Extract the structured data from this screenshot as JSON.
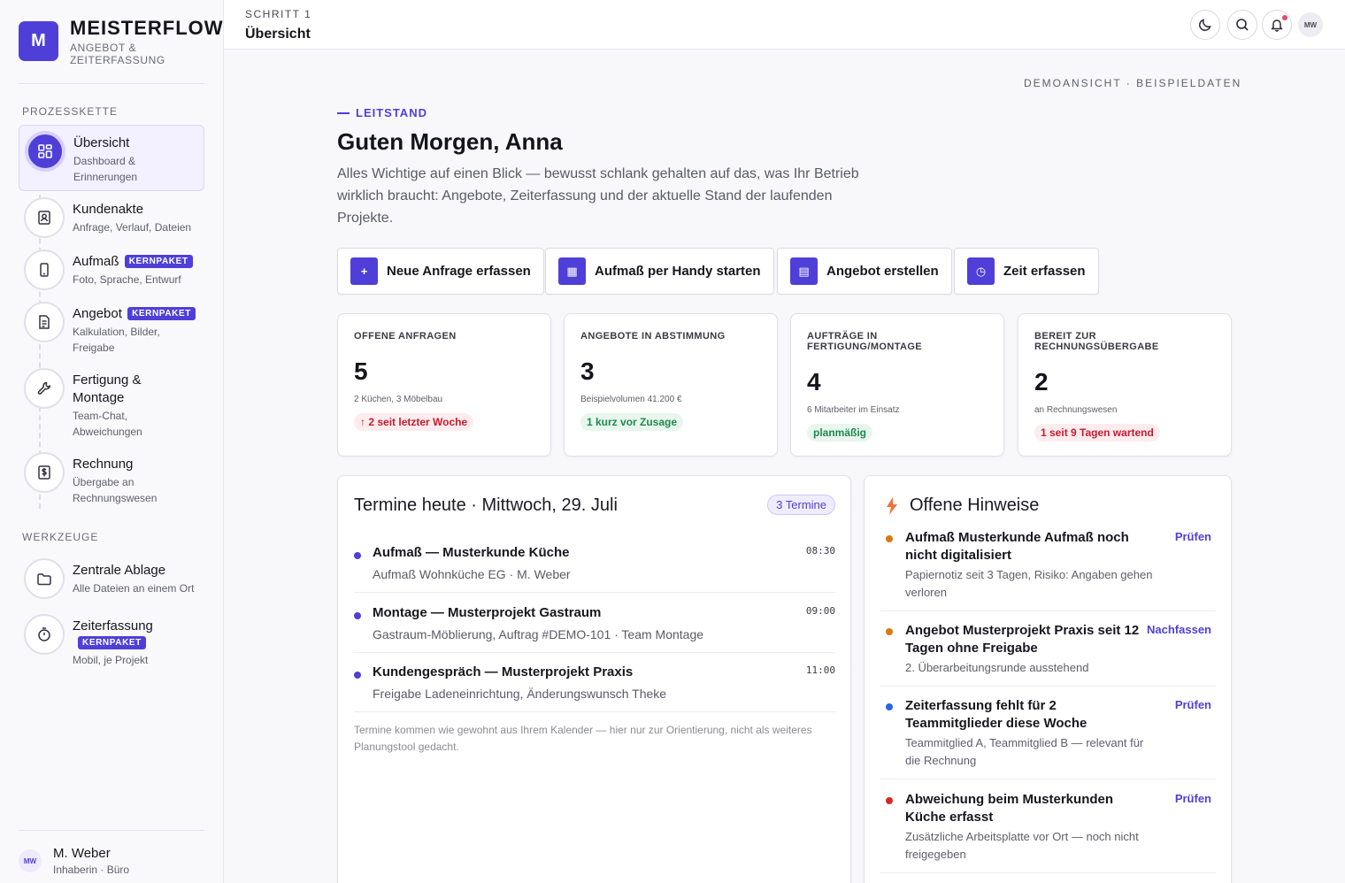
{
  "brand": {
    "logo_letter": "M",
    "name": "MEISTERFLOW",
    "subtitle": "ANGEBOT & ZEITERFASSUNG"
  },
  "sidebar": {
    "section_process": "PROZESSKETTE",
    "section_tools": "WERKZEUGE",
    "items": [
      {
        "title": "Übersicht",
        "sub": "Dashboard & Erinnerungen",
        "icon": "dashboard-icon"
      },
      {
        "title": "Kundenakte",
        "sub": "Anfrage, Verlauf, Dateien",
        "icon": "contact-card-icon"
      },
      {
        "title": "Aufmaß",
        "badge": "KERNPAKET",
        "sub": "Foto, Sprache, Entwurf",
        "icon": "phone-icon"
      },
      {
        "title": "Angebot",
        "badge": "KERNPAKET",
        "sub": "Kalkulation, Bilder, Freigabe",
        "icon": "document-icon"
      },
      {
        "title": "Fertigung & Montage",
        "sub": "Team-Chat, Abweichungen",
        "icon": "wrench-icon"
      },
      {
        "title": "Rechnung",
        "sub": "Übergabe an Rechnungswesen",
        "icon": "invoice-icon"
      }
    ],
    "tools": [
      {
        "title": "Zentrale Ablage",
        "sub": "Alle Dateien an einem Ort",
        "icon": "folder-icon"
      },
      {
        "title": "Zeiterfassung",
        "badge": "KERNPAKET",
        "sub": "Mobil, je Projekt",
        "icon": "stopwatch-icon"
      }
    ],
    "user": {
      "initials": "MW",
      "name": "M. Weber",
      "role": "Inhaberin · Büro"
    }
  },
  "topbar": {
    "step": "SCHRITT 1",
    "title": "Übersicht",
    "avatar_initials": "MW"
  },
  "main": {
    "demo_label": "DEMOANSICHT · BEISPIELDATEN",
    "eyebrow": "LEITSTAND",
    "greeting": "Guten Morgen, Anna",
    "intro": "Alles Wichtige auf einen Blick — bewusst schlank gehalten auf das, was Ihr Betrieb wirklich braucht: Angebote, Zeiterfassung und der aktuelle Stand der laufenden Projekte.",
    "quick_actions": [
      {
        "label": "Neue Anfrage erfassen",
        "icon_glyph": "+"
      },
      {
        "label": "Aufmaß per Handy starten",
        "icon_glyph": "▦"
      },
      {
        "label": "Angebot erstellen",
        "icon_glyph": "▤"
      },
      {
        "label": "Zeit erfassen",
        "icon_glyph": "◷"
      }
    ],
    "stats": [
      {
        "label": "OFFENE ANFRAGEN",
        "value": "5",
        "detail": "2 Küchen, 3 Möbelbau",
        "pill": "↑ 2 seit letzter Woche",
        "tone": "red"
      },
      {
        "label": "ANGEBOTE IN ABSTIMMUNG",
        "value": "3",
        "detail": "Beispielvolumen 41.200 €",
        "pill": "1 kurz vor Zusage",
        "tone": "green"
      },
      {
        "label": "AUFTRÄGE IN FERTIGUNG/MONTAGE",
        "value": "4",
        "detail": "6 Mitarbeiter im Einsatz",
        "pill": "planmäßig",
        "tone": "green"
      },
      {
        "label": "BEREIT ZUR RECHNUNGSÜBERGABE",
        "value": "2",
        "detail": "an Rechnungswesen",
        "pill": "1 seit 9 Tagen wartend",
        "tone": "red"
      }
    ],
    "appointments": {
      "title": "Termine heute · Mittwoch, 29. Juli",
      "count": "3 Termine",
      "items": [
        {
          "title": "Aufmaß — Musterkunde Küche",
          "sub": "Aufmaß Wohnküche EG · M. Weber",
          "time": "08:30"
        },
        {
          "title": "Montage — Musterprojekt Gastraum",
          "sub": "Gastraum-Möblierung, Auftrag #DEMO-101 · Team Montage",
          "time": "09:00"
        },
        {
          "title": "Kundengespräch — Musterprojekt Praxis",
          "sub": "Freigabe Ladeneinrichtung, Änderungswunsch Theke",
          "time": "11:00"
        }
      ],
      "note": "Termine kommen wie gewohnt aus Ihrem Kalender — hier nur zur Orientierung, nicht als weiteres Planungstool gedacht."
    },
    "hints": {
      "title": "Offene Hinweise",
      "items": [
        {
          "title": "Aufmaß Musterkunde Aufmaß noch nicht digitalisiert",
          "sub": "Papiernotiz seit 3 Tagen, Risiko: Angaben gehen verloren",
          "action": "Prüfen",
          "color": "#d97a0c"
        },
        {
          "title": "Angebot Musterprojekt Praxis seit 12 Tagen ohne Freigabe",
          "sub": "2. Überarbeitungsrunde ausstehend",
          "action": "Nachfassen",
          "color": "#d97a0c"
        },
        {
          "title": "Zeiterfassung fehlt für 2 Teammitglieder diese Woche",
          "sub": "Teammitglied A, Teammitglied B — relevant für die Rechnung",
          "action": "Prüfen",
          "color": "#2563eb"
        },
        {
          "title": "Abweichung beim Musterkunden Küche erfasst",
          "sub": "Zusätzliche Arbeitsplatte vor Ort — noch nicht freigegeben",
          "action": "Prüfen",
          "color": "#dc2626"
        }
      ]
    }
  }
}
